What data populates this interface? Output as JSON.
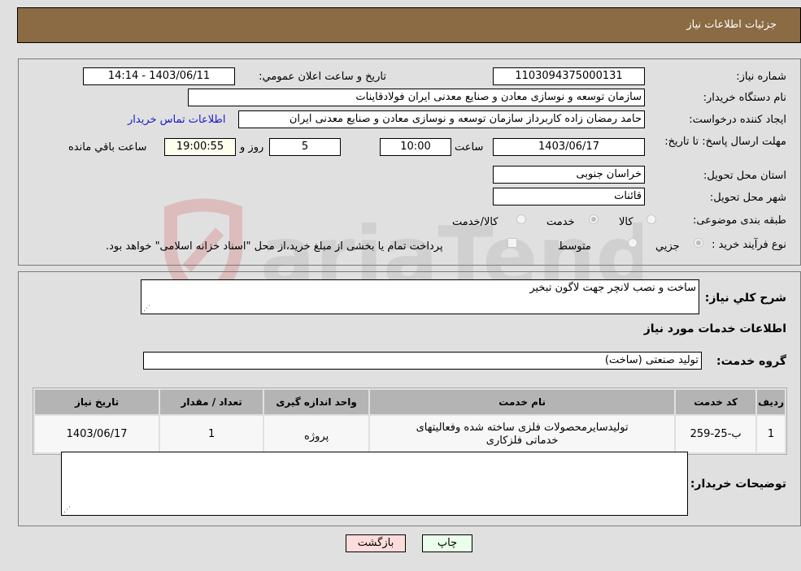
{
  "header": {
    "title": "جزئيات اطلاعات نياز"
  },
  "form": {
    "need_number": {
      "label": "شماره نیاز:",
      "value": "1103094375000131"
    },
    "announce_datetime": {
      "label": "تاريخ و ساعت اعلان عمومي:",
      "value": "1403/06/11 - 14:14"
    },
    "buyer_org": {
      "label": "نام دستگاه خریدار:",
      "value": "سازمان توسعه و نوسازی معادن و صنایع معدنی ایران فولادقاینات"
    },
    "requester": {
      "label": "ایجاد کننده درخواست:",
      "value": "حامد  رمضان زاده  کاربرداز  سازمان توسعه و نوسازی معادن و صنایع معدنی ایران",
      "contact_link": "اطلاعات تماس خریدار"
    },
    "deadline": {
      "label": "مهلت ارسال پاسخ: تا تاریخ:",
      "date": "1403/06/17",
      "time_label": "ساعت",
      "time": "10:00",
      "days": "5",
      "days_label": "روز و",
      "remaining": "19:00:55",
      "remaining_label": "ساعت باقي مانده"
    },
    "province": {
      "label": "استان محل تحویل:",
      "value": "خراسان جنوبی"
    },
    "city": {
      "label": "شهر محل تحویل:",
      "value": "قائنات"
    },
    "category": {
      "label": "طبقه بندی موضوعی:",
      "options": [
        {
          "label": "کالا",
          "selected": false
        },
        {
          "label": "خدمت",
          "selected": true
        },
        {
          "label": "کالا/خدمت",
          "selected": false
        }
      ]
    },
    "purchase_type": {
      "label": "نوع فرآیند خرید :",
      "options": [
        {
          "label": "جزيي",
          "selected": true
        },
        {
          "label": "متوسط",
          "selected": false
        }
      ],
      "treasury_note": "پرداخت تمام یا بخشی از مبلغ خرید،از محل \"اسناد خزانه اسلامی\" خواهد بود.",
      "treasury_checked": false
    }
  },
  "details": {
    "description_label": "شرح کلي نياز:",
    "description": "ساخت و نصب لانچر جهت لاگون تبخیر",
    "services_heading": "اطلاعات خدمات مورد نياز",
    "service_group_label": "گروه خدمت:",
    "service_group": "تولید صنعتی (ساخت)",
    "table": {
      "headers": [
        "رديف",
        "کد خدمت",
        "نام خدمت",
        "واحد اندازه گیری",
        "تعداد / مقدار",
        "تاريخ نياز"
      ],
      "rows": [
        [
          "1",
          "ب-25-259",
          "تولیدسایرمحصولات فلزی ساخته شده وفعالیتهای خدماتی فلزکاری",
          "پروژه",
          "1",
          "1403/06/17"
        ]
      ]
    },
    "buyer_notes_label": "توضیحات خریدار:",
    "buyer_notes": ""
  },
  "buttons": {
    "print": "چاپ",
    "back": "بازگشت"
  },
  "colors": {
    "header_bg": "#8b6b43",
    "print_bg": "#eaffea",
    "back_bg": "#ffdcdc",
    "link": "#1a1acc"
  }
}
